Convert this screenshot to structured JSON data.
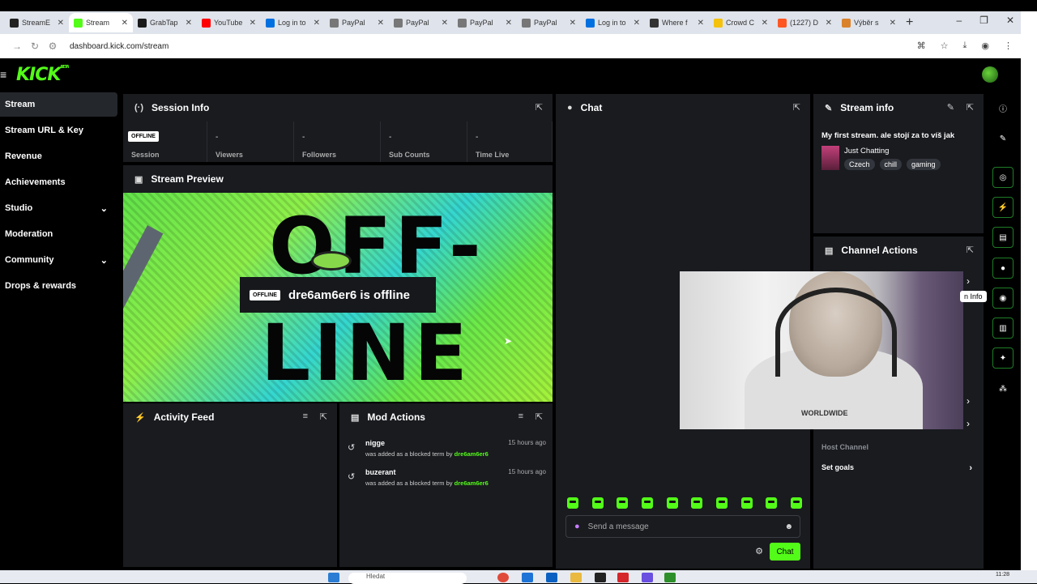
{
  "browser": {
    "tabs": [
      {
        "label": "StreamE",
        "color": "#222222"
      },
      {
        "label": "Stream",
        "color": "#53fc18",
        "active": true
      },
      {
        "label": "GrabTap",
        "color": "#1a1a1a"
      },
      {
        "label": "YouTube",
        "color": "#ff0000"
      },
      {
        "label": "Log in to",
        "color": "#0070e0"
      },
      {
        "label": "PayPal",
        "color": "#777777"
      },
      {
        "label": "PayPal",
        "color": "#777777"
      },
      {
        "label": "PayPal",
        "color": "#777777"
      },
      {
        "label": "PayPal",
        "color": "#777777"
      },
      {
        "label": "Log in to",
        "color": "#0070e0"
      },
      {
        "label": "Where f",
        "color": "#333333"
      },
      {
        "label": "Crowd C",
        "color": "#f4c20d"
      },
      {
        "label": "(1227) D",
        "color": "#ff5722"
      },
      {
        "label": "Výběr s",
        "color": "#d9822b"
      }
    ],
    "new_tab": "+",
    "url": "dashboard.kick.com/stream"
  },
  "app": {
    "logo": "KICK",
    "logo_sup": "BETA"
  },
  "sidebar": {
    "items": [
      {
        "label": "Stream",
        "active": true
      },
      {
        "label": "Stream URL & Key"
      },
      {
        "label": "Revenue"
      },
      {
        "label": "Achievements"
      },
      {
        "label": "Studio",
        "expand": true
      },
      {
        "label": "Moderation"
      },
      {
        "label": "Community",
        "expand": true
      },
      {
        "label": "Drops & rewards"
      }
    ]
  },
  "session": {
    "title": "Session Info",
    "badge": "OFFLINE",
    "cells": [
      {
        "label": "Session",
        "value": ""
      },
      {
        "label": "Viewers",
        "value": "-"
      },
      {
        "label": "Followers",
        "value": "-"
      },
      {
        "label": "Sub Counts",
        "value": "-"
      },
      {
        "label": "Time Live",
        "value": "-"
      }
    ]
  },
  "preview": {
    "title": "Stream Preview",
    "big_text_1": "OFF-",
    "big_text_2": "LINE",
    "badge": "OFFLINE",
    "offline_text": "dre6am6er6 is offline"
  },
  "activity": {
    "title": "Activity Feed"
  },
  "mod_actions": {
    "title": "Mod Actions",
    "rows": [
      {
        "name": "nigge",
        "desc": "was added as a blocked term by",
        "by": "dre6am6er6",
        "time": "15 hours ago"
      },
      {
        "name": "buzerant",
        "desc": "was added as a blocked term by",
        "by": "dre6am6er6",
        "time": "15 hours ago"
      }
    ]
  },
  "chat": {
    "title": "Chat",
    "placeholder": "Send a message",
    "send_label": "Chat",
    "emote_count": 10
  },
  "stream_info": {
    "title": "Stream info",
    "stream_title": "My first stream. ale stojí za to víš jak",
    "category": "Just Chatting",
    "tags": [
      "Czech",
      "chill",
      "gaming"
    ]
  },
  "channel_actions": {
    "title": "Channel Actions",
    "rows": [
      {
        "label": "Host Channel",
        "dim": true
      },
      {
        "label": "Set goals",
        "arrow": true
      }
    ]
  },
  "overlay": {
    "tooltip": "n Info",
    "hoodie_text": "WORLDWIDE"
  },
  "taskbar": {
    "search": "Hledat",
    "time": "11:28"
  },
  "colors": {
    "brand": "#53fc18",
    "panel": "#191b1f",
    "background": "#000000"
  }
}
